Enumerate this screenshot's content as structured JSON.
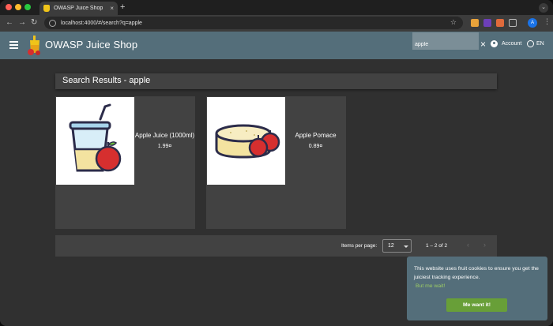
{
  "browser": {
    "tab_title": "OWASP Juice Shop",
    "tab_close": "×",
    "new_tab": "+",
    "url": "localhost:4000/#/search?q=apple",
    "profile_initial": "A",
    "back": "←",
    "forward": "→",
    "reload": "↻",
    "star": "☆",
    "menu": "⋮",
    "tabstrip_menu": "⌄"
  },
  "app": {
    "title": "OWASP Juice Shop",
    "search": {
      "value": "apple",
      "placeholder": ""
    },
    "search_close": "×",
    "account_label": "Account",
    "language_label": "EN"
  },
  "results": {
    "title": "Search Results - apple",
    "products": [
      {
        "name": "Apple Juice (1000ml)",
        "price": "1.99¤"
      },
      {
        "name": "Apple Pomace",
        "price": "0.89¤"
      }
    ]
  },
  "paginator": {
    "items_per_page_label": "Items per page:",
    "items_per_page_value": "12",
    "range_label": "1 – 2 of 2",
    "prev": "‹",
    "next": "›"
  },
  "cookie": {
    "message": "This website uses fruit cookies to ensure you get the juiciest tracking experience.",
    "link_label": "But me wait!",
    "button_label": "Me want it!"
  },
  "colors": {
    "app_bar": "#546e7a",
    "accent": "#689f38",
    "link": "#9ccc65",
    "card": "#424242",
    "background": "#303030"
  },
  "icons": {
    "menu": "menu-icon",
    "account": "account-circle-icon",
    "language": "globe-icon",
    "close": "close-icon"
  }
}
